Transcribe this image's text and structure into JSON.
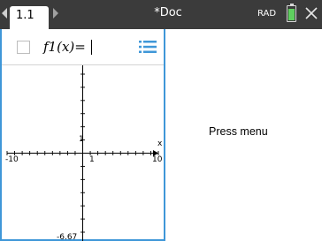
{
  "topbar": {
    "active_tab": "1.1",
    "document_title": "*Doc",
    "angle_mode": "RAD",
    "colors": {
      "bar": "#3b3b3b",
      "battery": "#5fd05f"
    },
    "icons": [
      "prev-tab-arrow-icon",
      "next-tab-arrow-icon",
      "battery-icon",
      "close-icon"
    ],
    "battery_level": 0.85
  },
  "graph": {
    "entry_label": "f1(x)=",
    "entry_value": "",
    "entry_menu_icon": "list-menu-icon",
    "accent_color": "#3f97d8",
    "axes": {
      "xmin": -10,
      "xmax": 10,
      "ymin": -6.67,
      "ymax": 6.67,
      "x_scale": 1,
      "y_scale": 1
    },
    "labels": {
      "xmin": "-10",
      "xmax": "10",
      "xtick": "1",
      "ytick": "1",
      "ymin": "-6.67",
      "x_axis": "x"
    }
  },
  "notes": {
    "hint": "Press menu"
  }
}
